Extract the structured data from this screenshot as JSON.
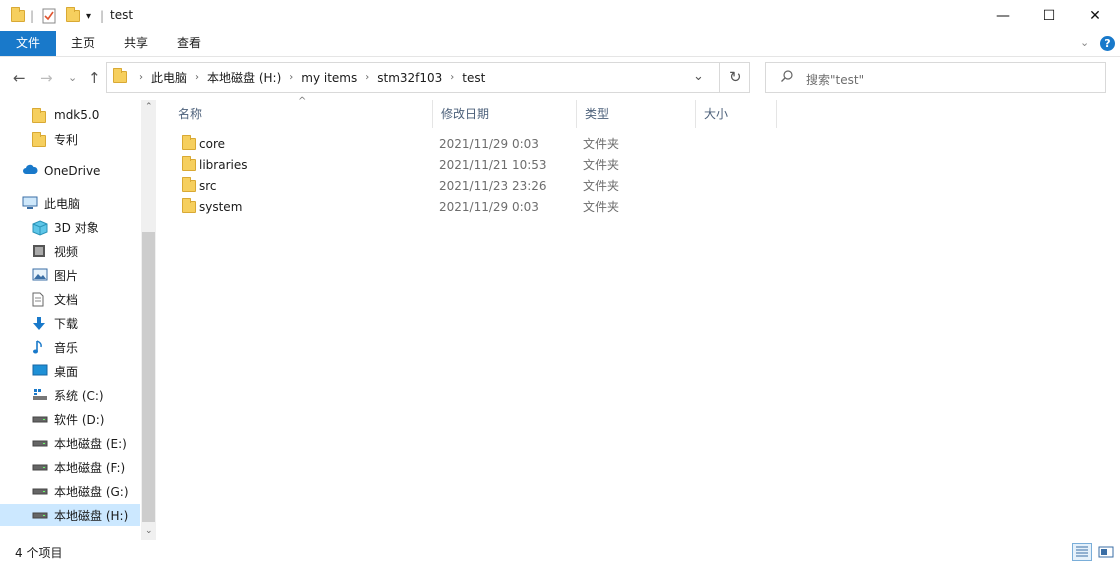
{
  "window": {
    "title": "test"
  },
  "window_controls": {
    "minimize": "—",
    "maximize": "☐",
    "close": "✕"
  },
  "ribbon": {
    "tabs": [
      "文件",
      "主页",
      "共享",
      "查看"
    ]
  },
  "nav_buttons": {
    "back": "←",
    "forward": "→",
    "recent": "⌄",
    "up": "↑",
    "dropdown": "⌄",
    "refresh": "↻"
  },
  "address": {
    "crumbs": [
      "此电脑",
      "本地磁盘 (H:)",
      "my items",
      "stm32f103",
      "test"
    ]
  },
  "search": {
    "placeholder": "搜索\"test\""
  },
  "nav_pane": {
    "items": [
      {
        "label": "mdk5.0",
        "icon": "folder-icon"
      },
      {
        "label": "专利",
        "icon": "folder-icon"
      },
      {
        "label": "OneDrive",
        "icon": "cloud-icon"
      },
      {
        "label": "此电脑",
        "icon": "computer-icon"
      },
      {
        "label": "3D 对象",
        "icon": "cube-icon"
      },
      {
        "label": "视频",
        "icon": "video-icon"
      },
      {
        "label": "图片",
        "icon": "picture-icon"
      },
      {
        "label": "文档",
        "icon": "document-icon"
      },
      {
        "label": "下载",
        "icon": "download-icon"
      },
      {
        "label": "音乐",
        "icon": "music-icon"
      },
      {
        "label": "桌面",
        "icon": "desktop-icon"
      },
      {
        "label": "系统 (C:)",
        "icon": "system-drive-icon"
      },
      {
        "label": "软件 (D:)",
        "icon": "drive-icon"
      },
      {
        "label": "本地磁盘 (E:)",
        "icon": "drive-icon"
      },
      {
        "label": "本地磁盘 (F:)",
        "icon": "drive-icon"
      },
      {
        "label": "本地磁盘 (G:)",
        "icon": "drive-icon"
      },
      {
        "label": "本地磁盘 (H:)",
        "icon": "drive-icon",
        "selected": true
      }
    ]
  },
  "file_list": {
    "columns": [
      "名称",
      "修改日期",
      "类型",
      "大小"
    ],
    "rows": [
      {
        "name": "core",
        "date": "2021/11/29 0:03",
        "type": "文件夹"
      },
      {
        "name": "libraries",
        "date": "2021/11/21 10:53",
        "type": "文件夹"
      },
      {
        "name": "src",
        "date": "2021/11/23 23:26",
        "type": "文件夹"
      },
      {
        "name": "system",
        "date": "2021/11/29 0:03",
        "type": "文件夹"
      }
    ]
  },
  "status_bar": {
    "item_count": "4 个项目"
  }
}
